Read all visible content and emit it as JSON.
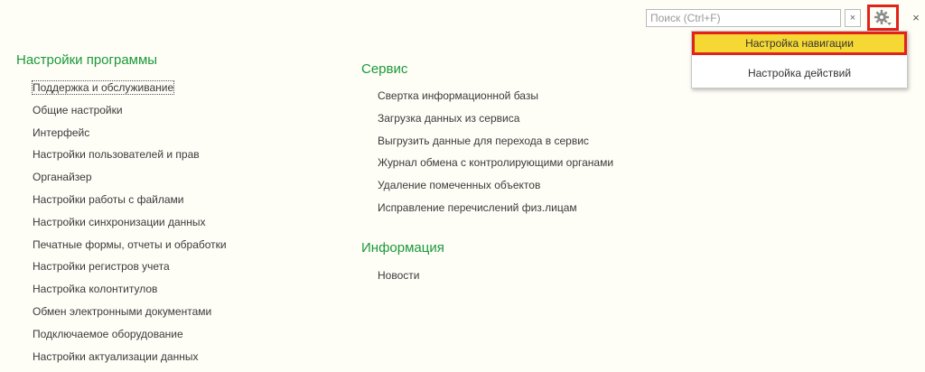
{
  "search": {
    "placeholder": "Поиск (Ctrl+F)",
    "value": "",
    "clear_label": "×"
  },
  "toolbar": {
    "gear_icon": "gear-icon",
    "close_label": "×"
  },
  "dropdown": {
    "items": [
      {
        "label": "Настройка навигации",
        "highlighted": true
      },
      {
        "label": "Настройка действий",
        "highlighted": false
      }
    ]
  },
  "sections": {
    "program_settings": {
      "title": "Настройки программы",
      "items": [
        "Поддержка и обслуживание",
        "Общие настройки",
        "Интерфейс",
        "Настройки пользователей и прав",
        "Органайзер",
        "Настройки работы с файлами",
        "Настройки синхронизации данных",
        "Печатные формы, отчеты и обработки",
        "Настройки регистров учета",
        "Настройка колонтитулов",
        "Обмен электронными документами",
        "Подключаемое оборудование",
        "Настройки актуализации данных"
      ]
    },
    "service": {
      "title": "Сервис",
      "items": [
        "Свертка информационной базы",
        "Загрузка данных из сервиса",
        "Выгрузить данные для перехода в сервис",
        "Журнал обмена с контролирующими органами",
        "Удаление помеченных объектов",
        "Исправление перечислений физ.лицам"
      ]
    },
    "info": {
      "title": "Информация",
      "items": [
        "Новости"
      ]
    }
  },
  "colors": {
    "accent_green": "#1a9a3a",
    "highlight_red": "#e2231a",
    "menu_selected": "#f6d835",
    "background": "#fefdf6"
  }
}
